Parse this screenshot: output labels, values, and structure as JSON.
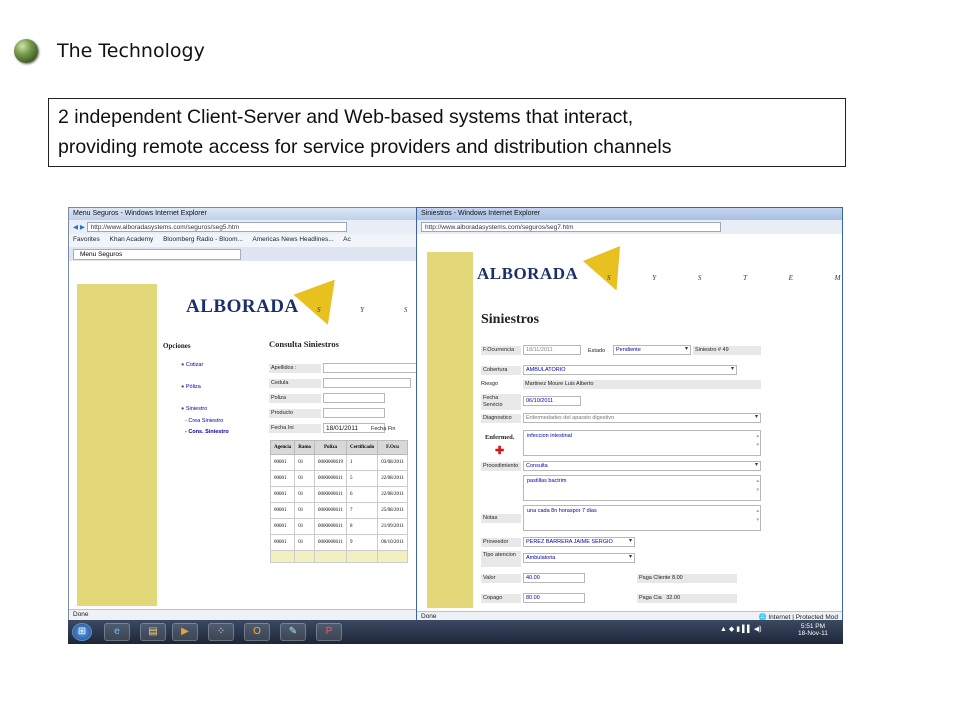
{
  "slide": {
    "title": "The Technology",
    "body_line1": "2 independent Client-Server and Web-based systems that interact,",
    "body_line2": "providing remote access for service providers and distribution channels"
  },
  "colors": {
    "bullet": "#5a7d3a",
    "panel": "#e2d87a",
    "logo": "#1d2f6b",
    "triangle": "#e8c020",
    "taskbar": "#2a3548"
  },
  "left_window": {
    "title": "Menu Seguros - Windows Internet Explorer",
    "url": "http://www.alboradasystems.com/seguros/seg5.htm",
    "favorites": [
      "Favorites",
      "Khan Academy",
      "Bloomberg Radio - Bloom...",
      "Americas News Headlines...",
      "Ac"
    ],
    "tab": "Menu Seguros",
    "logo": "ALBORADA",
    "logo_sub": "S Y S T E",
    "menu_title": "Opciones",
    "menu": [
      "Cotizar",
      "Póliza",
      "Siniestro"
    ],
    "submenu": [
      "- Crea Siniestro",
      "- Cons. Siniestro"
    ],
    "form_title": "Consulta Siniestros",
    "fields": [
      "Apellidos :",
      "Cedula",
      "Poliza",
      "Producto",
      "Fecha Ini"
    ],
    "fecha_ini": "18/01/2011",
    "fecha_fin": "Fecha Fin",
    "headers": [
      "Agencia",
      "Ramo",
      "Poliza",
      "Certificado",
      "F.Ocu"
    ],
    "rows": [
      [
        "00001",
        "01",
        "0000000619",
        "1",
        "03/08/2011"
      ],
      [
        "00001",
        "01",
        "0000000611",
        "5",
        "22/08/2011"
      ],
      [
        "00001",
        "01",
        "0000000611",
        "6",
        "22/08/2011"
      ],
      [
        "00001",
        "01",
        "0000000611",
        "7",
        "25/08/2011"
      ],
      [
        "00001",
        "01",
        "0000000611",
        "8",
        "21/09/2011"
      ],
      [
        "00001",
        "01",
        "0000000611",
        "9",
        "06/10/2011"
      ]
    ],
    "status": "Done"
  },
  "right_window": {
    "title": "Siniestros - Windows Internet Explorer",
    "url": "http://www.alboradasystems.com/seguros/seg7.htm",
    "logo": "ALBORADA",
    "logo_sub": "S Y S T E M S",
    "heading": "Siniestros",
    "f_ocurrencia_label": "F.Ocurrencia",
    "f_ocurrencia": "18/11/2011",
    "estado_label": "Estado",
    "estado": "Pendiente",
    "siniestro_no": "Siniestro # 49",
    "cobertura_label": "Cobertura",
    "cobertura": "AMBULATORIO",
    "riesgo_label": "Riesgo",
    "riesgo": "Martinez Moure Luis Alberto",
    "fecha_servicio_label": "Fecha Servicio",
    "fecha_servicio": "06/10/2011",
    "diagnostico_label": "Diagnostico",
    "diagnostico": "Enfermedades del aparato digestivo",
    "enfermedad_label": "Enfermed.",
    "enfermedad": "infeccion intestinal",
    "procedimiento_label": "Procedimiento",
    "procedimiento": "Consulta",
    "medicamentos": "pastillas bactrim",
    "notas_label": "Notas",
    "notas": "una cada 8n horaspor 7 dias",
    "proveedor_label": "Proveedor",
    "proveedor": "PEREZ BARRERA JAIME SERGIO",
    "tipo_label": "Tipo atencion",
    "tipo": "Ambulatoria",
    "valor_label": "Valor",
    "valor": "40.00",
    "paga_cliente_label": "Paga Cliente",
    "paga_cliente": "8.00",
    "copago_label": "Copago",
    "copago": "80.00",
    "paga_cia_label": "Paga Cia",
    "paga_cia": "32.00",
    "status": "Done",
    "zone": "Internet | Protected Mod"
  },
  "taskbar": {
    "time": "5:51 PM",
    "date": "18-Nov-11"
  }
}
